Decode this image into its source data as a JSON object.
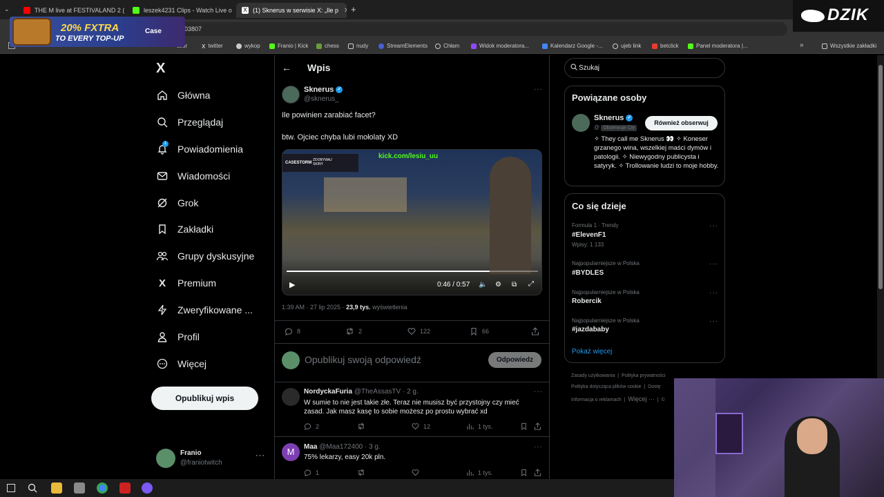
{
  "browser": {
    "tabs": [
      {
        "label": "THE M live at FESTIVALAND 2 (",
        "favicon": "youtube-icon",
        "color": "#ff0000"
      },
      {
        "label": "leszek4231 Clips - Watch Live o",
        "favicon": "kick-icon",
        "color": "#53fc18"
      },
      {
        "label": "(1) Sknerus w serwisie X: „Ile p",
        "favicon": "x-icon",
        "color": "#ffffff"
      }
    ],
    "url": "103807",
    "bookmarks": [
      "alior",
      "twitter",
      "wykop",
      "Franio | Kick",
      "chess",
      "nudy",
      "StreamElements",
      "Chłam",
      "Widok moderatora...",
      "Kalendarz Google -...",
      "ujeb link",
      "betclick",
      "Panel moderatora |..."
    ],
    "all_bookmarks": "Wszystkie zakładki"
  },
  "ad": {
    "line1": "20% FXTRA",
    "line2": "TO EVERY TOP-UP",
    "logo": "Case"
  },
  "overlay_logo": "DZIK",
  "sidebar": {
    "logo": "X",
    "items": [
      {
        "label": "Główna",
        "icon": "home-icon"
      },
      {
        "label": "Przeglądaj",
        "icon": "search-icon"
      },
      {
        "label": "Powiadomienia",
        "icon": "bell-icon",
        "badge": "1"
      },
      {
        "label": "Wiadomości",
        "icon": "envelope-icon"
      },
      {
        "label": "Grok",
        "icon": "grok-icon"
      },
      {
        "label": "Zakładki",
        "icon": "bookmark-icon"
      },
      {
        "label": "Grupy dyskusyjne",
        "icon": "people-icon"
      },
      {
        "label": "Premium",
        "icon": "x-icon"
      },
      {
        "label": "Zweryfikowane ...",
        "icon": "lightning-icon"
      },
      {
        "label": "Profil",
        "icon": "person-icon"
      },
      {
        "label": "Więcej",
        "icon": "more-circle-icon"
      }
    ],
    "post_button": "Opublikuj wpis",
    "account": {
      "name": "Franio",
      "handle": "@franiotwitch"
    }
  },
  "post": {
    "header": "Wpis",
    "author": "Sknerus",
    "handle": "@sknerus_",
    "text1": "Ile powinien zarabiać facet?",
    "text2": "btw. Ojciec chyba lubi mołolaty XD",
    "video": {
      "overlay_url": "kick.com/lesiu_uu",
      "overlay_promo": "ZDOBYWAJ SKINY",
      "overlay_brand": "CASESTORM",
      "time": "0:46 / 0:57",
      "progress": 0.807
    },
    "time": "1:39 AM · 27 lip 2025 · ",
    "views_count": "23,9 tys.",
    "views_label": " wyświetlenia",
    "replies": "8",
    "reposts": "2",
    "likes": "122",
    "bookmarks": "66",
    "reply_placeholder": "Opublikuj swoją odpowiedź",
    "reply_button": "Odpowiedz"
  },
  "replies": [
    {
      "author": "NordyckaFuria",
      "handle": "@TheAssasTV · 2 g.",
      "text": "W sumie to nie jest takie złe. Teraz nie musisz być przystojny czy mieć zasad. Jak masz kasę to sobie możesz po prostu wybrać xd",
      "replies": "2",
      "reposts": "",
      "likes": "12",
      "views": "1 tys."
    },
    {
      "author": "Maa",
      "handle": "@Maa172400 · 3 g.",
      "text": "75% lekarzy, easy 20k pln.",
      "replies": "1",
      "reposts": "",
      "likes": "",
      "views": "1 tys.",
      "avatar_letter": "M"
    }
  ],
  "right": {
    "search_placeholder": "Szukaj",
    "related_title": "Powiązane osoby",
    "related": {
      "name": "Sknerus",
      "handle": "@",
      "follows_you": "Obserwuje Cię",
      "follow_button": "Również obserwuj",
      "bio": "✧ They call me Sknerus 👀 ✧ Koneser grzanego wina, wszelkiej maści dymów i patologii. ✧ Niewygodny publicysta i satyryk. ✧ Trollowanie ludzi to moje hobby."
    },
    "trends_title": "Co się dzieje",
    "trends": [
      {
        "meta": "Formula 1 · Trendy",
        "name": "#ElevenF1",
        "count": "Wpisy: 1 133"
      },
      {
        "meta": "Najpopularniejsze w Polska",
        "name": "#BYDLES",
        "count": ""
      },
      {
        "meta": "Najpopularniejsze w Polska",
        "name": "Robercik",
        "count": ""
      },
      {
        "meta": "Najpopularniejsze w Polska",
        "name": "#jazdababy",
        "count": ""
      }
    ],
    "show_more": "Pokaż więcej",
    "footer": [
      "Zasady użytkowania",
      "Polityka prywatności",
      "Polityka dotycząca plików cookie",
      "Dostę",
      "Informacja o reklamach",
      "Więcej ···",
      "©"
    ]
  },
  "colors": {
    "accent": "#1d9bf0",
    "bg": "#000000",
    "border": "#2f3336",
    "muted": "#71767b"
  }
}
